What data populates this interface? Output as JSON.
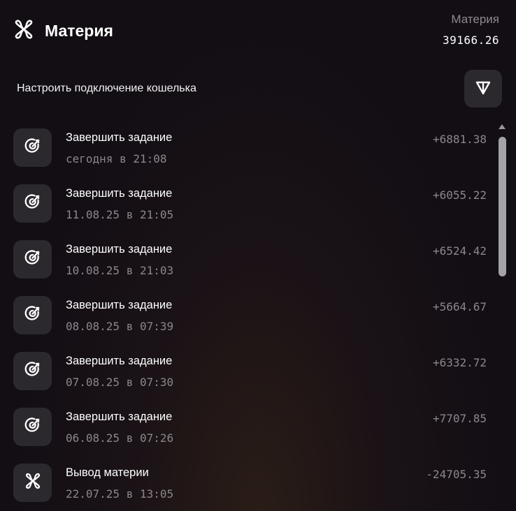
{
  "header": {
    "title": "Материя",
    "logo_icon": "x-knot-logo-icon",
    "balance_label": "Материя",
    "balance_value": "39166.26"
  },
  "wallet": {
    "label": "Настроить подключение кошелька",
    "button_icon": "ton-icon"
  },
  "transactions": [
    {
      "icon": "target-icon",
      "title": "Завершить задание",
      "date": "сегодня в 21:08",
      "amount": "+6881.38"
    },
    {
      "icon": "target-icon",
      "title": "Завершить задание",
      "date": "11.08.25 в 21:05",
      "amount": "+6055.22"
    },
    {
      "icon": "target-icon",
      "title": "Завершить задание",
      "date": "10.08.25 в 21:03",
      "amount": "+6524.42"
    },
    {
      "icon": "target-icon",
      "title": "Завершить задание",
      "date": "08.08.25 в 07:39",
      "amount": "+5664.67"
    },
    {
      "icon": "target-icon",
      "title": "Завершить задание",
      "date": "07.08.25 в 07:30",
      "amount": "+6332.72"
    },
    {
      "icon": "target-icon",
      "title": "Завершить задание",
      "date": "06.08.25 в 07:26",
      "amount": "+7707.85"
    },
    {
      "icon": "x-knot-logo-icon",
      "title": "Вывод материи",
      "date": "22.07.25 в 13:05",
      "amount": "-24705.35"
    }
  ]
}
